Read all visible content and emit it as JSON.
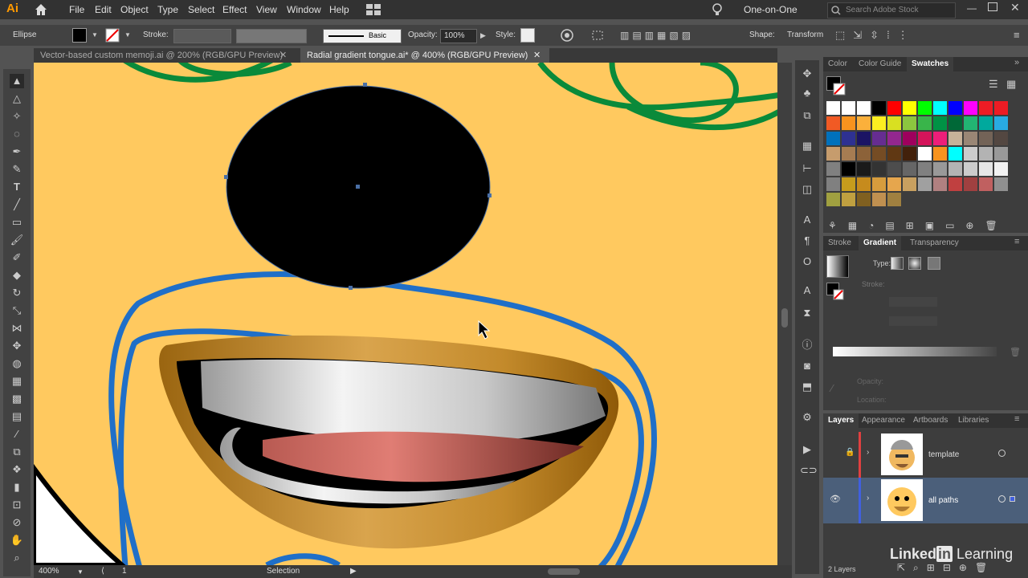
{
  "app": {
    "logo": "Ai",
    "home_icon": "home-icon"
  },
  "menubar": {
    "items": [
      "File",
      "Edit",
      "Object",
      "Type",
      "Select",
      "Effect",
      "View",
      "Window",
      "Help"
    ],
    "workspace": "One-on-One",
    "search_placeholder": "Search Adobe Stock"
  },
  "control_bar": {
    "selection_label": "Ellipse",
    "stroke_label": "Stroke:",
    "brush_label": "Basic",
    "opacity_label": "Opacity:",
    "opacity_value": "100%",
    "style_label": "Style:",
    "shape_label": "Shape:",
    "transform_label": "Transform"
  },
  "document_tabs": [
    {
      "label": "Vector-based custom memoji.ai @ 200% (RGB/GPU Preview)",
      "active": false
    },
    {
      "label": "Radial gradient tongue.ai* @ 400% (RGB/GPU Preview)",
      "active": true
    }
  ],
  "status_bar": {
    "zoom": "400%",
    "artboard": "1",
    "tool": "Selection"
  },
  "panels": {
    "swatches": {
      "tabs": [
        "Color",
        "Color Guide",
        "Swatches"
      ],
      "active_tab": "Swatches",
      "rows": [
        [
          "#ffffff",
          "#ffffff",
          "#ffffff",
          "#000000",
          "#ff0000",
          "#ffff00",
          "#00ff00",
          "#00ffff",
          "#0000ff",
          "#ff00ff",
          "#ed1c24",
          "#ed1c24"
        ],
        [
          "#f15a24",
          "#f7931e",
          "#fbb03b",
          "#fcee21",
          "#d9e021",
          "#8cc63f",
          "#39b54a",
          "#009245",
          "#006837",
          "#22b573",
          "#00a99d",
          "#29abe2"
        ],
        [
          "#0071bc",
          "#2e3192",
          "#1b1464",
          "#662d91",
          "#93278f",
          "#9e005d",
          "#d4145a",
          "#ed1e79",
          "#c7b299",
          "#998675",
          "#736357",
          "#534741"
        ],
        [
          "#c69c6d",
          "#a67c52",
          "#8c6239",
          "#754c24",
          "#603813",
          "#42210b",
          "#ffffff",
          "#f7931e",
          "#00ffff",
          "#cccccc",
          "#b3b3b3",
          "#999999"
        ],
        [
          "#808080",
          "#000000",
          "#1a1a1a",
          "#333333",
          "#4d4d4d",
          "#666666",
          "#808080",
          "#999999",
          "#b3b3b3",
          "#cccccc",
          "#e6e6e6",
          "#f2f2f2"
        ],
        [
          "#808080",
          "#c69c1d",
          "#c68b1d",
          "#d69c3d",
          "#e6a64d",
          "#c8a060",
          "#a0a0a0",
          "#b08080",
          "#c04040",
          "#a04040",
          "#c06060",
          "#909090"
        ],
        [
          "#a0a040",
          "#c0a040",
          "#806020",
          "#c09050",
          "#a08040"
        ]
      ]
    },
    "gradient": {
      "tabs": [
        "Stroke",
        "Gradient",
        "Transparency"
      ],
      "active_tab": "Gradient",
      "type_label": "Type:",
      "stroke_label": "Stroke:",
      "opacity_label": "Opacity:",
      "location_label": "Location:"
    },
    "layers": {
      "tabs": [
        "Layers",
        "Appearance",
        "Artboards",
        "Libraries"
      ],
      "active_tab": "Layers",
      "items": [
        {
          "name": "template",
          "color": "#e04040",
          "locked": true,
          "visible": false,
          "selected": false
        },
        {
          "name": "all paths",
          "color": "#4060e0",
          "locked": false,
          "visible": true,
          "selected": true
        }
      ],
      "count_label": "2 Layers"
    }
  },
  "watermark": {
    "text1": "Linked",
    "text2": "in",
    "text3": " Learning"
  },
  "colors": {
    "canvas": "#ffc95f",
    "outline": "#1f6fc8",
    "hair": "#0a8a3a",
    "accent": "#4a6fa5"
  }
}
